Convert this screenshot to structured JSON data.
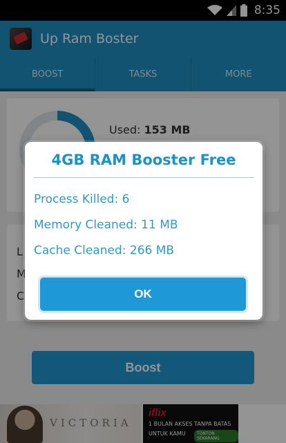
{
  "status_bar": {
    "time": "8:35"
  },
  "app_bar": {
    "title": "Up Ram Boster"
  },
  "tabs": [
    {
      "label": "BOOST",
      "active": true
    },
    {
      "label": "TASKS",
      "active": false
    },
    {
      "label": "MORE",
      "active": false
    }
  ],
  "memory": {
    "used_label": "Used:",
    "used_value": "153 MB"
  },
  "info_card": {
    "partial_letters": [
      "L",
      "M",
      "C"
    ]
  },
  "boost_button_label": "Boost",
  "dialog": {
    "title": "4GB RAM Booster Free",
    "lines": [
      "Process Killed: 6",
      "Memory Cleaned: 11 MB",
      "Cache Cleaned: 266 MB"
    ],
    "ok_label": "OK"
  },
  "ad": {
    "left_brand": "VICTORIA",
    "right_brand": "iflix",
    "right_line1": "1 BULAN AKSES TANPA BATAS",
    "right_line2": "UNTUK KAMU",
    "right_cta": "TONTON SEKARANG"
  },
  "colors": {
    "accent": "#1f8fc4",
    "dialog_text": "#1a93c9",
    "button": "#1e98d6"
  }
}
